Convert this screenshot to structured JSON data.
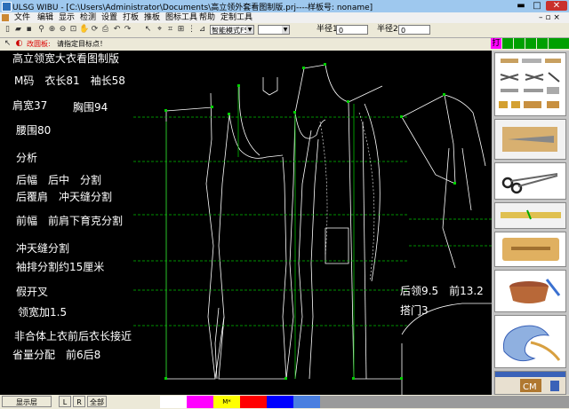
{
  "window": {
    "title": "ULSG WIBU - [C:\\Users\\Administrator\\Documents\\高立领外套看图制版.prj----样板号: noname]",
    "minimize": "▬",
    "maximize": "□",
    "close": "✕"
  },
  "menu": {
    "items": [
      "文件",
      "编辑",
      "显示",
      "检测",
      "设置",
      "打板",
      "推板",
      "图标工具",
      "帮助",
      "定制工具"
    ],
    "mdi_controls": "– ▫ ×"
  },
  "toolbar": {
    "mode_select": "智能模式F5",
    "blank_select": "",
    "radius1_label": "半径1",
    "radius1_value": "0",
    "radius2_label": "半径2",
    "radius2_value": "0"
  },
  "statusbar": {
    "mode_label": "改圆板:",
    "message": "请指定目标点！"
  },
  "canvas_notes": [
    "高立领宽大衣看图制版",
    "M码　衣长81　袖长58",
    "肩宽37",
    "胸围94",
    "腰围80",
    "分析",
    "后幅　后中　分割",
    "后覆肩　冲天缝分割",
    "前幅　前肩下育克分割",
    "冲天缝分割",
    "袖排分割约15厘米",
    "假开叉",
    "领宽加1.5",
    "非合体上衣前后衣长接近",
    "省量分配　前6后8",
    "后领9.5　前13.2",
    "搭门3"
  ],
  "bottom": {
    "layer_label": "显示层",
    "l": "L",
    "r": "R",
    "all": "全部",
    "m_label": "M*"
  },
  "palette": {
    "white": "#ffffff",
    "magenta": "#ff00ff",
    "yellow": "#ffff00",
    "red": "#ff0000",
    "blue": "#0000ff",
    "lightblue": "#4a7fe0",
    "grey": "#9a9a9a"
  },
  "side_icons": [
    "ruler-icon",
    "scissors-icon",
    "knife-icon",
    "scissors-icon",
    "tape-icon",
    "pattern-board-icon",
    "sewing-basket-icon",
    "french-curve-icon",
    "cm-logo-icon"
  ]
}
